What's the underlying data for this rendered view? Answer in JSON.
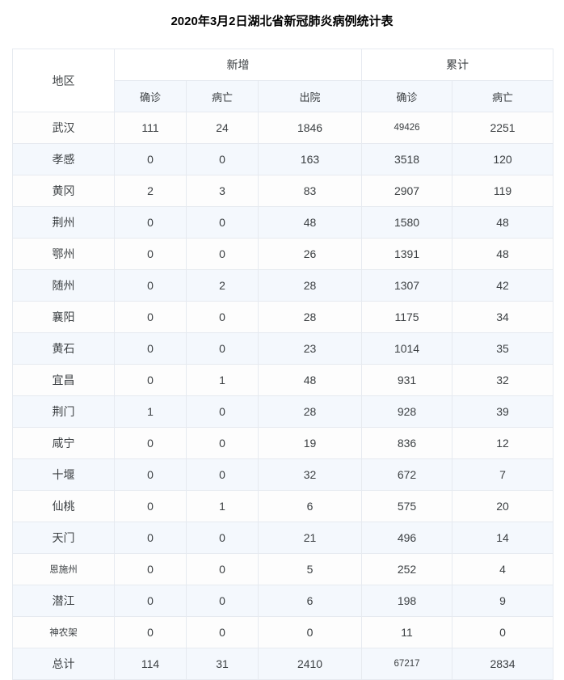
{
  "title": "2020年3月2日湖北省新冠肺炎病例统计表",
  "table": {
    "region_header": "地区",
    "groups": [
      {
        "label": "新增",
        "span": 3
      },
      {
        "label": "累计",
        "span": 2
      }
    ],
    "subheaders": [
      "确诊",
      "病亡",
      "出院",
      "确诊",
      "病亡"
    ],
    "rows": [
      {
        "region": "武汉",
        "region_small": false,
        "new_confirmed": "111",
        "new_deaths": "24",
        "new_discharged": "1846",
        "total_confirmed": "49426",
        "total_confirmed_small": true,
        "total_deaths": "2251"
      },
      {
        "region": "孝感",
        "region_small": false,
        "new_confirmed": "0",
        "new_deaths": "0",
        "new_discharged": "163",
        "total_confirmed": "3518",
        "total_confirmed_small": false,
        "total_deaths": "120"
      },
      {
        "region": "黄冈",
        "region_small": false,
        "new_confirmed": "2",
        "new_deaths": "3",
        "new_discharged": "83",
        "total_confirmed": "2907",
        "total_confirmed_small": false,
        "total_deaths": "119"
      },
      {
        "region": "荆州",
        "region_small": false,
        "new_confirmed": "0",
        "new_deaths": "0",
        "new_discharged": "48",
        "total_confirmed": "1580",
        "total_confirmed_small": false,
        "total_deaths": "48"
      },
      {
        "region": "鄂州",
        "region_small": false,
        "new_confirmed": "0",
        "new_deaths": "0",
        "new_discharged": "26",
        "total_confirmed": "1391",
        "total_confirmed_small": false,
        "total_deaths": "48"
      },
      {
        "region": "随州",
        "region_small": false,
        "new_confirmed": "0",
        "new_deaths": "2",
        "new_discharged": "28",
        "total_confirmed": "1307",
        "total_confirmed_small": false,
        "total_deaths": "42"
      },
      {
        "region": "襄阳",
        "region_small": false,
        "new_confirmed": "0",
        "new_deaths": "0",
        "new_discharged": "28",
        "total_confirmed": "1175",
        "total_confirmed_small": false,
        "total_deaths": "34"
      },
      {
        "region": "黄石",
        "region_small": false,
        "new_confirmed": "0",
        "new_deaths": "0",
        "new_discharged": "23",
        "total_confirmed": "1014",
        "total_confirmed_small": false,
        "total_deaths": "35"
      },
      {
        "region": "宜昌",
        "region_small": false,
        "new_confirmed": "0",
        "new_deaths": "1",
        "new_discharged": "48",
        "total_confirmed": "931",
        "total_confirmed_small": false,
        "total_deaths": "32"
      },
      {
        "region": "荆门",
        "region_small": false,
        "new_confirmed": "1",
        "new_deaths": "0",
        "new_discharged": "28",
        "total_confirmed": "928",
        "total_confirmed_small": false,
        "total_deaths": "39"
      },
      {
        "region": "咸宁",
        "region_small": false,
        "new_confirmed": "0",
        "new_deaths": "0",
        "new_discharged": "19",
        "total_confirmed": "836",
        "total_confirmed_small": false,
        "total_deaths": "12"
      },
      {
        "region": "十堰",
        "region_small": false,
        "new_confirmed": "0",
        "new_deaths": "0",
        "new_discharged": "32",
        "total_confirmed": "672",
        "total_confirmed_small": false,
        "total_deaths": "7"
      },
      {
        "region": "仙桃",
        "region_small": false,
        "new_confirmed": "0",
        "new_deaths": "1",
        "new_discharged": "6",
        "total_confirmed": "575",
        "total_confirmed_small": false,
        "total_deaths": "20"
      },
      {
        "region": "天门",
        "region_small": false,
        "new_confirmed": "0",
        "new_deaths": "0",
        "new_discharged": "21",
        "total_confirmed": "496",
        "total_confirmed_small": false,
        "total_deaths": "14"
      },
      {
        "region": "恩施州",
        "region_small": true,
        "new_confirmed": "0",
        "new_deaths": "0",
        "new_discharged": "5",
        "total_confirmed": "252",
        "total_confirmed_small": false,
        "total_deaths": "4"
      },
      {
        "region": "潜江",
        "region_small": false,
        "new_confirmed": "0",
        "new_deaths": "0",
        "new_discharged": "6",
        "total_confirmed": "198",
        "total_confirmed_small": false,
        "total_deaths": "9"
      },
      {
        "region": "神农架",
        "region_small": true,
        "new_confirmed": "0",
        "new_deaths": "0",
        "new_discharged": "0",
        "total_confirmed": "11",
        "total_confirmed_small": false,
        "total_deaths": "0"
      }
    ],
    "total_row": {
      "region": "总计",
      "region_small": false,
      "new_confirmed": "114",
      "new_deaths": "31",
      "new_discharged": "2410",
      "total_confirmed": "67217",
      "total_confirmed_small": true,
      "total_deaths": "2834"
    }
  },
  "colors": {
    "stripe": "#f4f8fd",
    "plain": "#fdfdfd",
    "border": "#e6eaf0",
    "outer_border": "#dcdfe3",
    "text": "#3c4043",
    "title": "#000000"
  }
}
